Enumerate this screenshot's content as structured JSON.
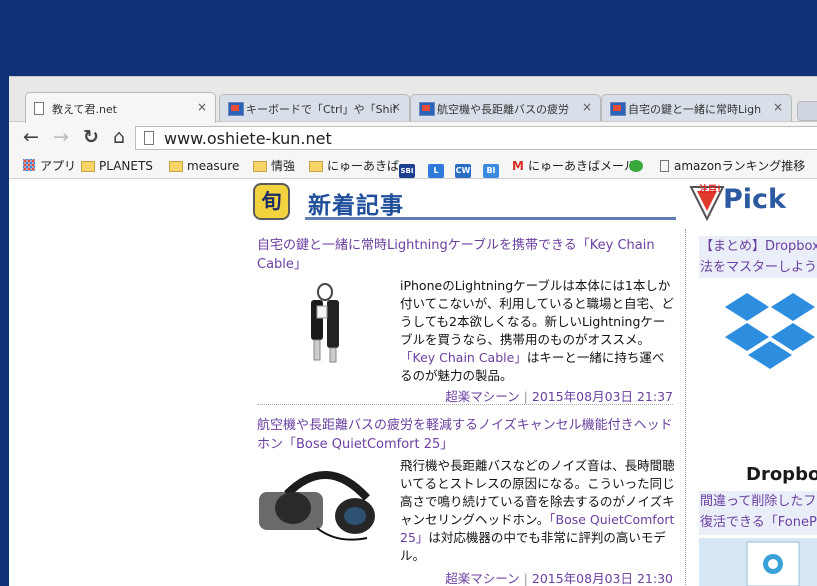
{
  "tabs": [
    {
      "title": "教えて君.net",
      "close": "×",
      "active": true
    },
    {
      "title": "キーボードで「Ctrl」や「Shift」",
      "close": "×",
      "active": false
    },
    {
      "title": "航空機や長距離バスの疲労",
      "close": "×",
      "active": false
    },
    {
      "title": "自宅の鍵と一緒に常時Ligh",
      "close": "×",
      "active": false
    }
  ],
  "toolbar": {
    "back_icon": "←",
    "forward_icon": "→",
    "reload_icon": "↻",
    "home_icon": "⌂",
    "url": "www.oshiete-kun.net"
  },
  "bookmarks": [
    {
      "label": "アプリ",
      "icon": "apps-grid-icon"
    },
    {
      "label": "PLANETS",
      "icon": "folder-icon"
    },
    {
      "label": "measure",
      "icon": "folder-icon"
    },
    {
      "label": "情強",
      "icon": "folder-icon"
    },
    {
      "label": "にゅーあきば",
      "icon": "folder-icon"
    },
    {
      "label": "SBI",
      "icon": "sbi-icon"
    },
    {
      "label": "L",
      "icon": "l-icon"
    },
    {
      "label": "CW",
      "icon": "cw-icon"
    },
    {
      "label": "BI",
      "icon": "bi-icon"
    },
    {
      "label": "にゅーあきばメール",
      "icon": "gmail-icon"
    },
    {
      "label": "",
      "icon": "frog-icon"
    },
    {
      "label": "amazonランキング推移",
      "icon": "page-icon"
    }
  ],
  "new_section": {
    "badge": "旬",
    "title": "新着記事"
  },
  "articles": [
    {
      "title": "自宅の鍵と一緒に常時Lightningケーブルを携帯できる「Key Chain Cable」",
      "summary_before": "iPhoneのLightningケーブルは本体には1本しか付いてこないが、利用していると職場と自宅、どうしても2本欲しくなる。新しいLightningケーブルを買うなら、携帯用のものがオススメ。",
      "summary_link": "「Key Chain Cable」",
      "summary_after": "はキーと一緒に持ち運べるのが魅力の製品。",
      "author": "超楽マシーン",
      "date": "2015年08月03日 21:37"
    },
    {
      "title": "航空機や長距離バスの疲労を軽減するノイズキャンセル機能付きヘッドホン「Bose QuietComfort 25」",
      "summary_before": "飛行機や長距離バスなどのノイズ音は、長時間聴いてるとストレスの原因になる。こういった同じ高さで鳴り続けている音を除去するのがノイズキャンセリングヘッドホン。",
      "summary_link": "「Bose QuietComfort 25」",
      "summary_after": "は対応機器の中でも非常に評判の高いモデル。",
      "author": "超楽マシーン",
      "date": "2015年08月03日 21:30"
    }
  ],
  "pickup": {
    "badge": "注目!",
    "title": "Pick",
    "items": [
      {
        "title_line1": "【まとめ】Dropboxで",
        "title_line2": "法をマスターしよう",
        "image_label": "Dropbox"
      },
      {
        "title_line1": "間違って削除したフ",
        "title_line2": "復活できる「FonePa"
      }
    ]
  },
  "colors": {
    "desktop": "#0f3276",
    "link": "#6b3fa0",
    "heading_blue": "#1f4f9a"
  }
}
